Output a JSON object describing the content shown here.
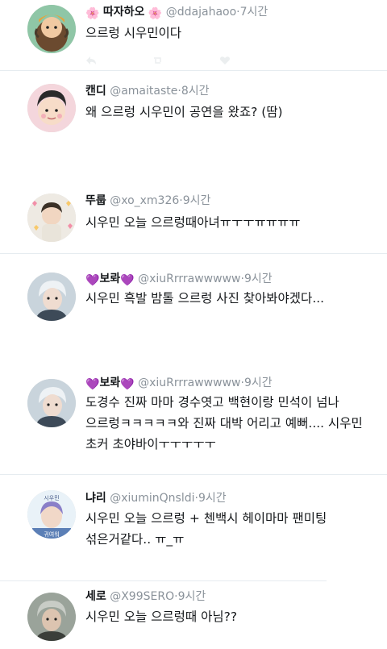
{
  "tweets": [
    {
      "name": "따자하오",
      "name_prefix_emoji": "🌸",
      "name_suffix_emoji": "🌸",
      "handle": "@ddajahaoo",
      "time": "7시간",
      "text": "으르렁 시우민이다"
    },
    {
      "name": "캔디",
      "handle": "@amaitaste",
      "time": "8시간",
      "text": "왜 으르렁 시우민이 공연을 왔죠? (땀)"
    },
    {
      "name": "뚜룹",
      "handle": "@xo_xm326",
      "time": "9시간",
      "text": "시우민 오늘 으르렁때아녀ㅠㅜㅜㅠㅠㅠㅠ"
    },
    {
      "name": "보롸",
      "name_prefix_emoji": "💜",
      "name_suffix_emoji": "💜",
      "handle": "@xiuRrrrawwwww",
      "time": "9시간",
      "text": "시우민 흑발 밤톨 으르렁 사진 찾아봐야겠다..."
    },
    {
      "name": "보롸",
      "name_prefix_emoji": "💜",
      "name_suffix_emoji": "💜",
      "handle": "@xiuRrrrawwwww",
      "time": "9시간",
      "text": "도경수 진짜 마마 경수엿고 백현이랑 민석이 넘나 으르렁ㅋㅋㅋㅋㅋ와 진짜 대박 어리고 예뻐.... 시우민 초커 초야바이ㅜㅜㅜㅜㅜ"
    },
    {
      "name": "냐리",
      "handle": "@xiuminQnsldi",
      "time": "9시간",
      "text": "시우민 오늘 으르렁 + 첸백시 헤이마마 팬미팅 섞은거같다.. ㅠ_ㅠ",
      "avatar_text_top": "시우민",
      "avatar_text_bottom": "귀여워"
    },
    {
      "name": "세로",
      "handle": "@X99SERO",
      "time": "9시간",
      "text": "시우민 오늘 으르렁때 아님??"
    }
  ],
  "separator": "·",
  "icons": [
    "reply-icon",
    "retweet-icon",
    "like-icon",
    "share-icon"
  ]
}
